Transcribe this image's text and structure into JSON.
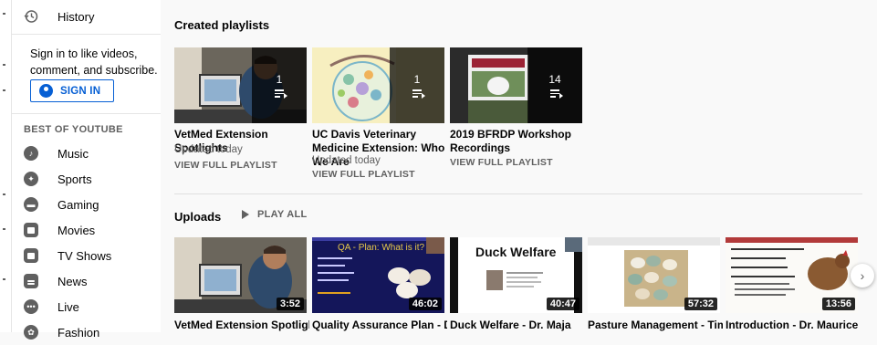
{
  "sidebar": {
    "history_label": "History",
    "signin_prompt": "Sign in to like videos, comment, and subscribe.",
    "signin_button": "SIGN IN",
    "best_title": "BEST OF YOUTUBE",
    "items": [
      {
        "label": "Music",
        "icon": "music-note-icon"
      },
      {
        "label": "Sports",
        "icon": "trophy-icon"
      },
      {
        "label": "Gaming",
        "icon": "gamepad-icon"
      },
      {
        "label": "Movies",
        "icon": "movies-icon"
      },
      {
        "label": "TV Shows",
        "icon": "tv-icon"
      },
      {
        "label": "News",
        "icon": "news-icon"
      },
      {
        "label": "Live",
        "icon": "live-icon"
      },
      {
        "label": "Fashion",
        "icon": "fashion-icon"
      }
    ]
  },
  "created_playlists": {
    "title": "Created playlists",
    "items": [
      {
        "count": "1",
        "title": "VetMed Extension Spotlights",
        "updated": "Updated today",
        "link": "VIEW FULL PLAYLIST"
      },
      {
        "count": "1",
        "title": "UC Davis Veterinary Medicine Extension: Who We Are",
        "updated": "Updated today",
        "link": "VIEW FULL PLAYLIST"
      },
      {
        "count": "14",
        "title": "2019 BFRDP Workshop Recordings",
        "updated": "",
        "link": "VIEW FULL PLAYLIST"
      }
    ]
  },
  "uploads": {
    "title": "Uploads",
    "play_all": "PLAY ALL",
    "videos": [
      {
        "title": "VetMed Extension Spotlight:",
        "duration": "3:52",
        "thumb_text": ""
      },
      {
        "title": "Quality Assurance Plan - Dr.",
        "duration": "46:02",
        "thumb_text": "QA - Plan:  What is it?"
      },
      {
        "title": "Duck Welfare - Dr. Maja",
        "duration": "40:47",
        "thumb_text": "Duck Welfare"
      },
      {
        "title": "Pasture Management - Tim",
        "duration": "57:32",
        "thumb_text": ""
      },
      {
        "title": "Introduction - Dr. Maurice",
        "duration": "13:56",
        "thumb_text": ""
      }
    ]
  },
  "colors": {
    "accent": "#065fd4",
    "text": "#030303",
    "secondary": "#606060"
  }
}
